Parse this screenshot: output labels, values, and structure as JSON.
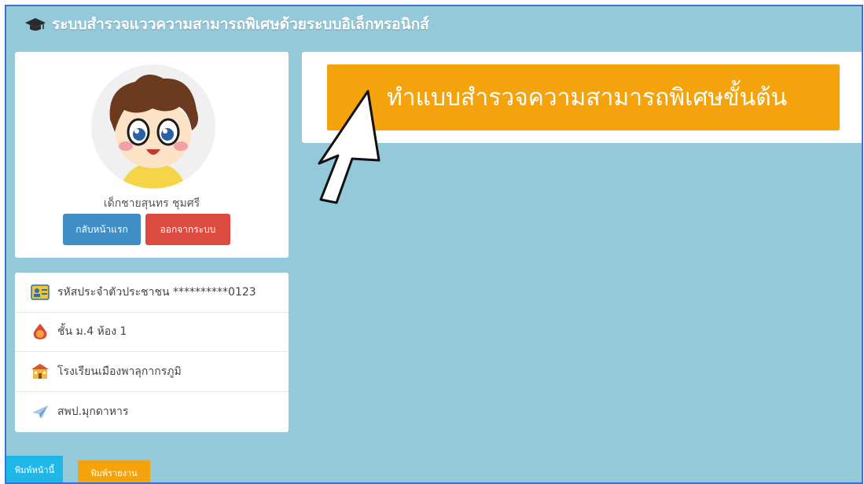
{
  "header": {
    "title": "ระบบสำรวจแววความสามารถพิเศษด้วยระบบอิเล็กทรอนิกส์",
    "icon": "graduation-cap-icon"
  },
  "profile": {
    "avatar_icon": "boy-avatar-icon",
    "name": "เด็กชายสุนทร ชุมศรี",
    "home_button": "กลับหน้าแรก",
    "logout_button": "ออกจากระบบ"
  },
  "info": {
    "items": [
      {
        "icon": "id-card-icon",
        "text": "รหัสประจำตัวประชาชน **********0123"
      },
      {
        "icon": "flame-icon",
        "text": "ชั้น ม.4 ห้อง 1"
      },
      {
        "icon": "school-building-icon",
        "text": "โรงเรียนเมืองพาลุกากรภูมิ"
      },
      {
        "icon": "paper-plane-icon",
        "text": "สพป.มุกดาหาร"
      }
    ]
  },
  "main": {
    "survey_button": "ทำแบบสำรวจความสามารถพิเศษขั้นต้น"
  },
  "footer": {
    "print_page": "พิมพ์หน้านี้",
    "print_report": "พิมพ์รายงาน"
  },
  "colors": {
    "background": "#93c9d9",
    "primary": "#3f8ec6",
    "danger": "#db4b3f",
    "warning": "#f4a30c",
    "info": "#1fb7e8"
  }
}
